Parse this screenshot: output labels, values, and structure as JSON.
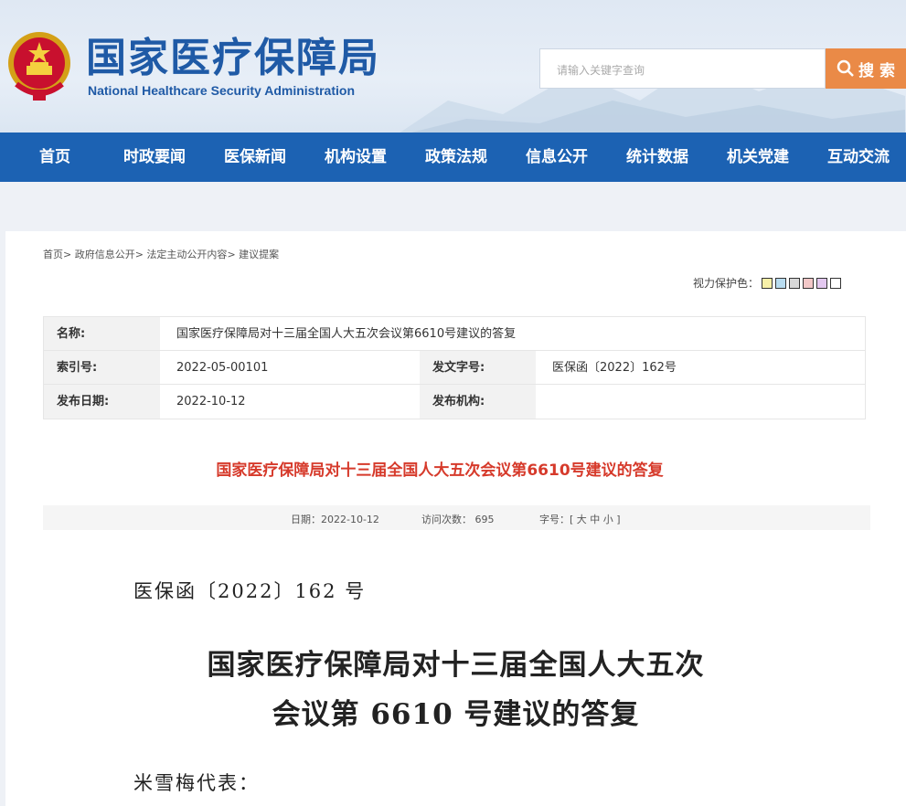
{
  "header": {
    "title": "国家医疗保障局",
    "subtitle": "National Healthcare Security Administration",
    "search_placeholder": "请输入关键字查询",
    "search_button": "搜 索",
    "emblem_icon": "national-emblem-icon"
  },
  "nav": {
    "items": [
      "首页",
      "时政要闻",
      "医保新闻",
      "机构设置",
      "政策法规",
      "信息公开",
      "统计数据",
      "机关党建",
      "互动交流"
    ]
  },
  "breadcrumb": {
    "items": [
      "首页",
      "政府信息公开",
      "法定主动公开内容",
      "建议提案"
    ],
    "separator": ">"
  },
  "eye_protect": {
    "label": "视力保护色：",
    "colors": [
      "#f7f0a8",
      "#b9dcf0",
      "#d8d8d8",
      "#f3c8c8",
      "#e3c8f0",
      "#ffffff"
    ]
  },
  "meta": {
    "name_label": "名称:",
    "name_value": "国家医疗保障局对十三届全国人大五次会议第6610号建议的答复",
    "index_label": "索引号:",
    "index_value": "2022-05-00101",
    "docno_label": "发文字号:",
    "docno_value": "医保函〔2022〕162号",
    "date_label": "发布日期:",
    "date_value": "2022-10-12",
    "org_label": "发布机构:",
    "org_value": ""
  },
  "article": {
    "title": "国家医疗保障局对十三届全国人大五次会议第6610号建议的答复",
    "date": "日期：2022-10-12",
    "visits": "访问次数：  695",
    "font_size": "字号：[ 大 中 小 ]"
  },
  "document": {
    "number": "医保函〔2022〕162 号",
    "heading_line1": "国家医疗保障局对十三届全国人大五次",
    "heading_line2": "会议第 6610 号建议的答复",
    "greeting": "米雪梅代表："
  }
}
